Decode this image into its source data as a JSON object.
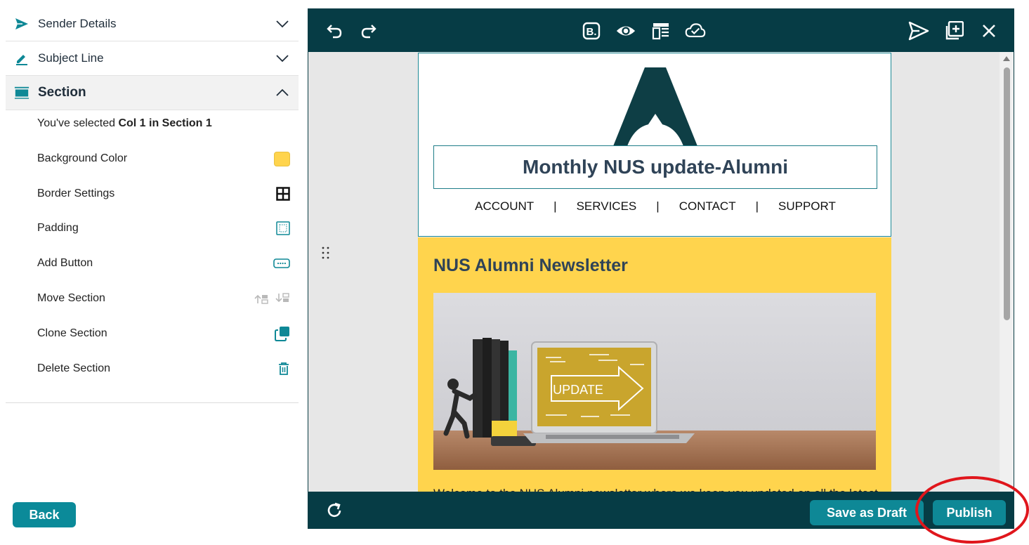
{
  "sidebar": {
    "accordion": [
      {
        "label": "Sender Details",
        "icon": "send-icon"
      },
      {
        "label": "Subject Line",
        "icon": "pencil-icon"
      },
      {
        "label": "Section",
        "icon": "section-icon"
      }
    ],
    "selection_prefix": "You've selected ",
    "selection_bold": "Col 1 in Section 1",
    "options": [
      {
        "label": "Background Color",
        "icon": "color-swatch-icon"
      },
      {
        "label": "Border Settings",
        "icon": "border-grid-icon"
      },
      {
        "label": "Padding",
        "icon": "padding-icon"
      },
      {
        "label": "Add Button",
        "icon": "button-icon"
      },
      {
        "label": "Move Section",
        "icon": "move-section-icon"
      },
      {
        "label": "Clone Section",
        "icon": "clone-icon"
      },
      {
        "label": "Delete Section",
        "icon": "trash-icon"
      }
    ],
    "background_color": "#ffd44d",
    "back_label": "Back"
  },
  "toolbar": {
    "icons": [
      "undo-icon",
      "redo-icon",
      "brand-icon",
      "preview-eye-icon",
      "layout-icon",
      "cloud-save-icon",
      "send-test-icon",
      "add-block-icon",
      "close-icon"
    ]
  },
  "email": {
    "title": "Monthly NUS update-Alumni",
    "nav": [
      "ACCOUNT",
      "SERVICES",
      "CONTACT",
      "SUPPORT"
    ],
    "nav_separator": "|",
    "newsletter_title": "NUS Alumni Newsletter",
    "image_text": "UPDATE",
    "welcome_text": "Welcome to the NUS Alumni newsletter where we keep you updated on all the latest"
  },
  "footer": {
    "save_draft_label": "Save as Draft",
    "publish_label": "Publish"
  },
  "colors": {
    "toolbar_bg": "#063c45",
    "accent": "#0e8896",
    "section_yellow": "#ffd44d",
    "annotation_red": "#e0161c"
  }
}
